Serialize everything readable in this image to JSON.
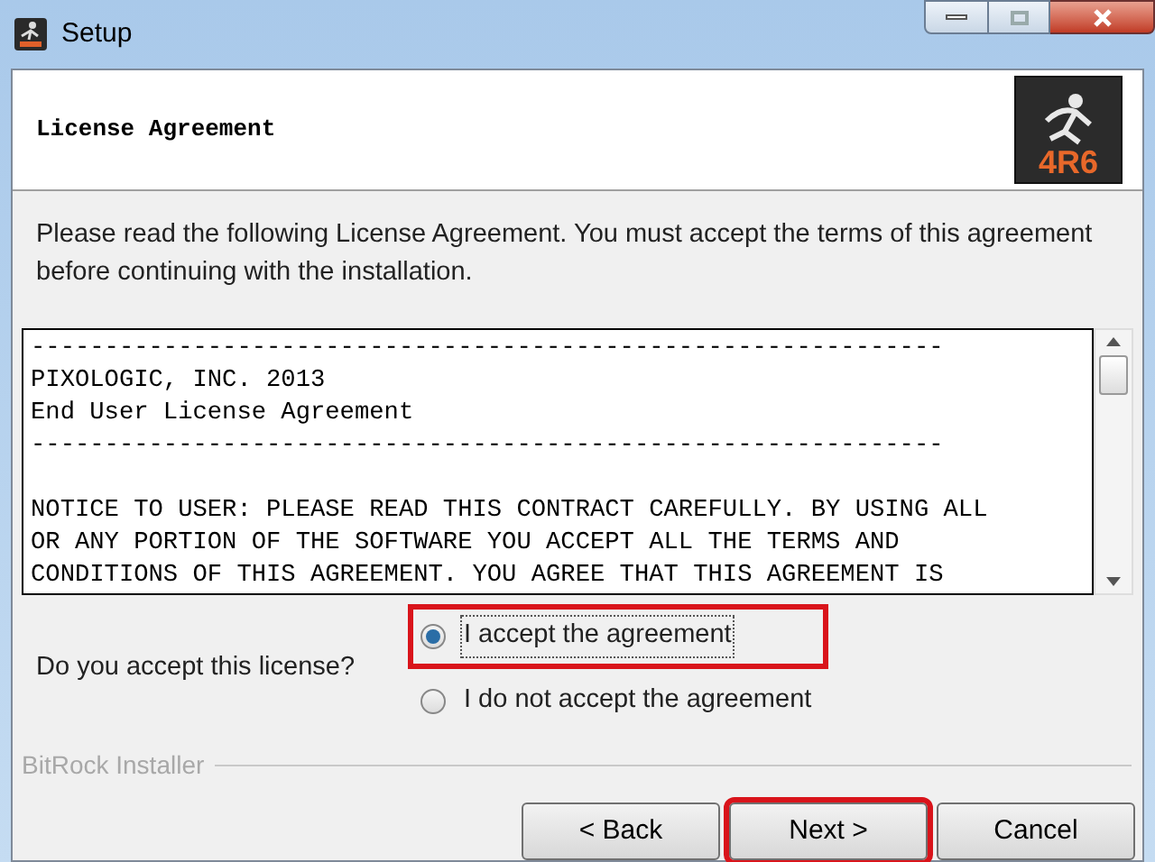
{
  "window": {
    "title": "Setup"
  },
  "header": {
    "title": "License Agreement",
    "logo_text": "4R6"
  },
  "description": "Please read the following License Agreement. You must accept the terms of this agreement before continuing with the installation.",
  "license_paragraphs": [
    [
      "--------------------------------------------------------------",
      "PIXOLOGIC, INC. 2013",
      "End User License Agreement",
      "--------------------------------------------------------------"
    ],
    [
      "NOTICE TO USER: PLEASE READ THIS CONTRACT CAREFULLY. BY USING ALL",
      "OR ANY PORTION OF THE SOFTWARE YOU ACCEPT ALL THE TERMS AND",
      "CONDITIONS OF THIS AGREEMENT. YOU AGREE THAT THIS AGREEMENT IS"
    ]
  ],
  "question": "Do you accept this license?",
  "options": [
    {
      "label": "I accept the agreement",
      "selected": true,
      "highlighted": true
    },
    {
      "label": "I do not accept the agreement",
      "selected": false,
      "highlighted": false
    }
  ],
  "footer_label": "BitRock Installer",
  "buttons": [
    {
      "label": "< Back",
      "highlighted": false
    },
    {
      "label": "Next >",
      "highlighted": true
    },
    {
      "label": "Cancel",
      "highlighted": false
    }
  ]
}
